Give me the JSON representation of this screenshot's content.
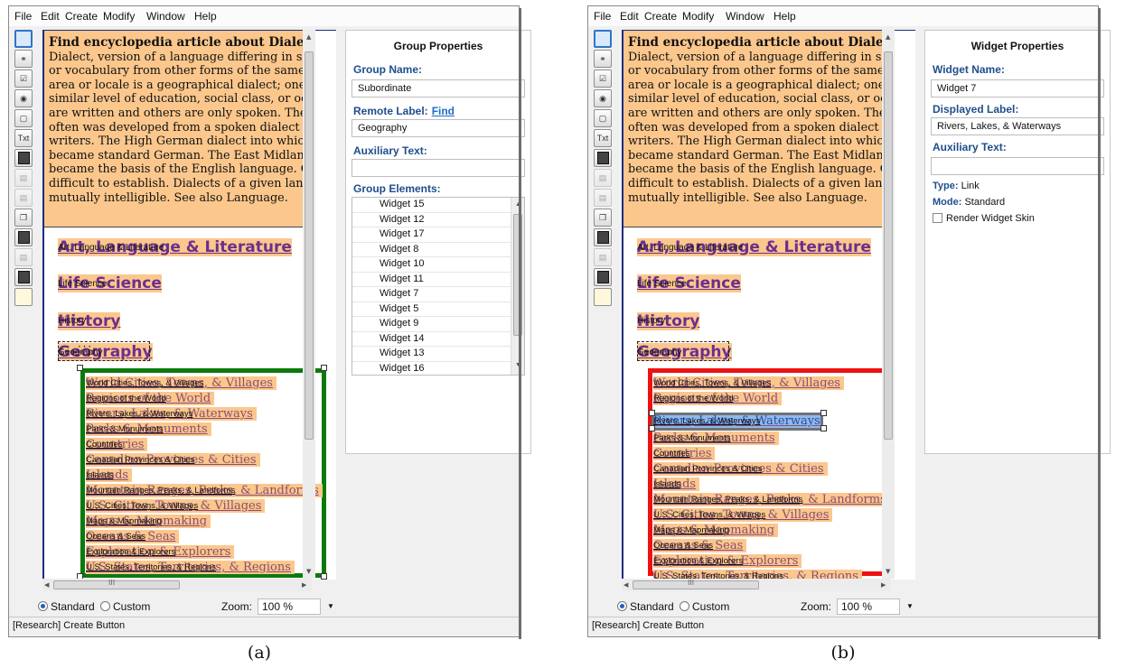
{
  "menu": [
    "File",
    "Edit",
    "Create",
    "Modify",
    "Window",
    "Help"
  ],
  "toolbar": [
    "page-icon",
    "link-icon",
    "checkbox-icon",
    "radio-icon",
    "frame-icon",
    "Txt",
    "list-icon",
    "list-dim-icon",
    "list-dim-icon",
    "stack-icon",
    "card-icon",
    "card-dim-icon",
    "table-icon",
    "note-icon"
  ],
  "article": {
    "lines": [
      "Find encyclopedia article about Dialec",
      "Dialect, version of a language differing in sor",
      "or vocabulary from other forms of the same la",
      "area or locale is a geographical dialect; one spe",
      "similar level of education, social class, or occup",
      "are written and others are only spoken. The st",
      "often was developed from a spoken dialect tha",
      "writers. The High German dialect into which L",
      "became standard German. The East Midland",
      "became the basis of the English language. Ofte",
      "difficult to establish. Dialects of a given langua",
      "mutually intelligible. See also Language."
    ]
  },
  "categories": [
    {
      "title": "Art, Language & Literature",
      "label": "Art, Language & Literature"
    },
    {
      "title": "Life Science",
      "label": "Life Science"
    },
    {
      "title": "History",
      "label": "History"
    },
    {
      "title": "Geography",
      "label": "Geography"
    }
  ],
  "subitems": [
    {
      "title": "World Cities, Towns, & Villages",
      "label": "World Cities, Towns, & Villages"
    },
    {
      "title": "Regions of the World",
      "label": "Regions of the World"
    },
    {
      "title": "Rivers, Lakes, & Waterways",
      "label": "Rivers, Lakes, & Waterways"
    },
    {
      "title": "Parks & Monuments",
      "label": "Parks & Monuments"
    },
    {
      "title": "Countries",
      "label": "Countries"
    },
    {
      "title": "Canadian Provinces & Cities",
      "label": "Canadian Provinces & Cities"
    },
    {
      "title": "Islands",
      "label": "Islands"
    },
    {
      "title": "Mountain Ranges, Peaks, & Landforms",
      "label": "Mountain Ranges, Peaks, & Landforms"
    },
    {
      "title": "U.S. Cities, Towns, & Villages",
      "label": "U.S. Cities, Towns, & Villages"
    },
    {
      "title": "Maps & Mapmaking",
      "label": "Maps & Mapmaking"
    },
    {
      "title": "Oceans & Seas",
      "label": "Oceans & Seas"
    },
    {
      "title": "Exploration & Explorers",
      "label": "Exploration & Explorers"
    },
    {
      "title": "U.S. States, Territories, & Regions",
      "label": "U.S. States, Territories, & Regions"
    }
  ],
  "bottom": {
    "standard": "Standard",
    "custom": "Custom",
    "zoom_label": "Zoom:",
    "zoom_value": "100 %",
    "status": "[Research] Create Button",
    "hscroll_mark": "III"
  },
  "panel_a": {
    "title": "Group Properties",
    "group_name_label": "Group Name:",
    "group_name_value": "Subordinate",
    "remote_label_label": "Remote Label:",
    "remote_label_link": "Find",
    "remote_label_value": "Geography",
    "aux_label": "Auxiliary Text:",
    "aux_value": "",
    "elements_label": "Group Elements:",
    "elements": [
      "Widget 15",
      "Widget 12",
      "Widget 17",
      "Widget 8",
      "Widget 10",
      "Widget 11",
      "Widget 7",
      "Widget 5",
      "Widget 9",
      "Widget 14",
      "Widget 13",
      "Widget 16"
    ]
  },
  "panel_b": {
    "title": "Widget Properties",
    "widget_name_label": "Widget Name:",
    "widget_name_value": "Widget 7",
    "displayed_label_label": "Displayed Label:",
    "displayed_label_value": "Rivers, Lakes, & Waterways",
    "aux_label": "Auxiliary Text:",
    "aux_value": "",
    "type_label": "Type:",
    "type_value": "Link",
    "mode_label": "Mode:",
    "mode_value": "Standard",
    "render_skin": "Render Widget Skin"
  },
  "captions": [
    "(a)",
    "(b)"
  ],
  "colors": {
    "group_border": "#0b7a0b",
    "widget_border": "#ee1111",
    "highlight": "#fbc78c",
    "link_purple": "#6b2f8e"
  }
}
